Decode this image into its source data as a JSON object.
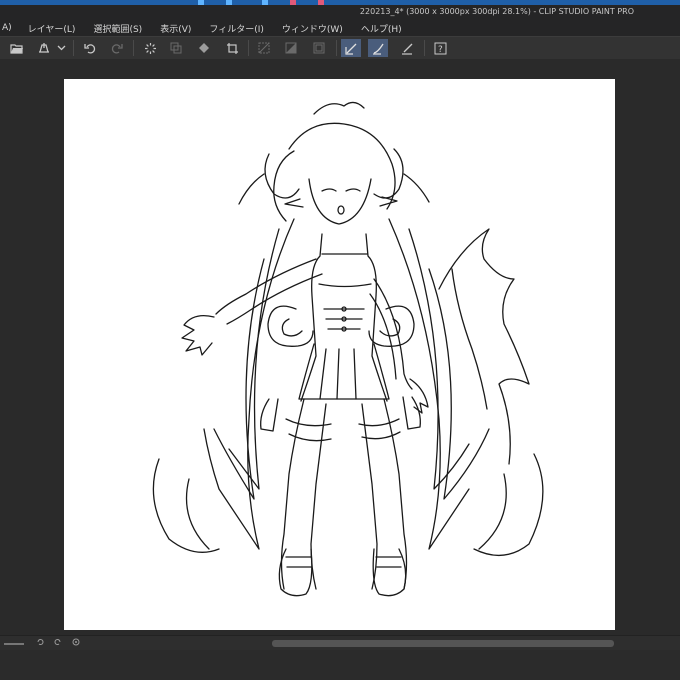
{
  "window": {
    "title": "220213_4* (3000 x 3000px 300dpi 28.1%) - CLIP STUDIO PAINT PRO"
  },
  "menu": {
    "items": [
      "A)",
      "レイヤー(L)",
      "選択範囲(S)",
      "表示(V)",
      "フィルター(I)",
      "ウィンドウ(W)",
      "ヘルプ(H)"
    ]
  },
  "toolbar": {
    "icons": [
      "open-folder",
      "save",
      "dropdown",
      "undo",
      "redo",
      "spinner",
      "clear",
      "fill",
      "transform",
      "select-none",
      "invert",
      "border",
      "ruler-snap",
      "special-ruler-snap",
      "grid-snap",
      "help"
    ]
  },
  "canvas": {
    "content": "line-art character drawing",
    "background": "#ffffff"
  },
  "colors": {
    "workspace": "#2a2a2a",
    "toolbar": "#333333",
    "active": "#4a5d7c",
    "titlebar": "#1f5fa8"
  }
}
